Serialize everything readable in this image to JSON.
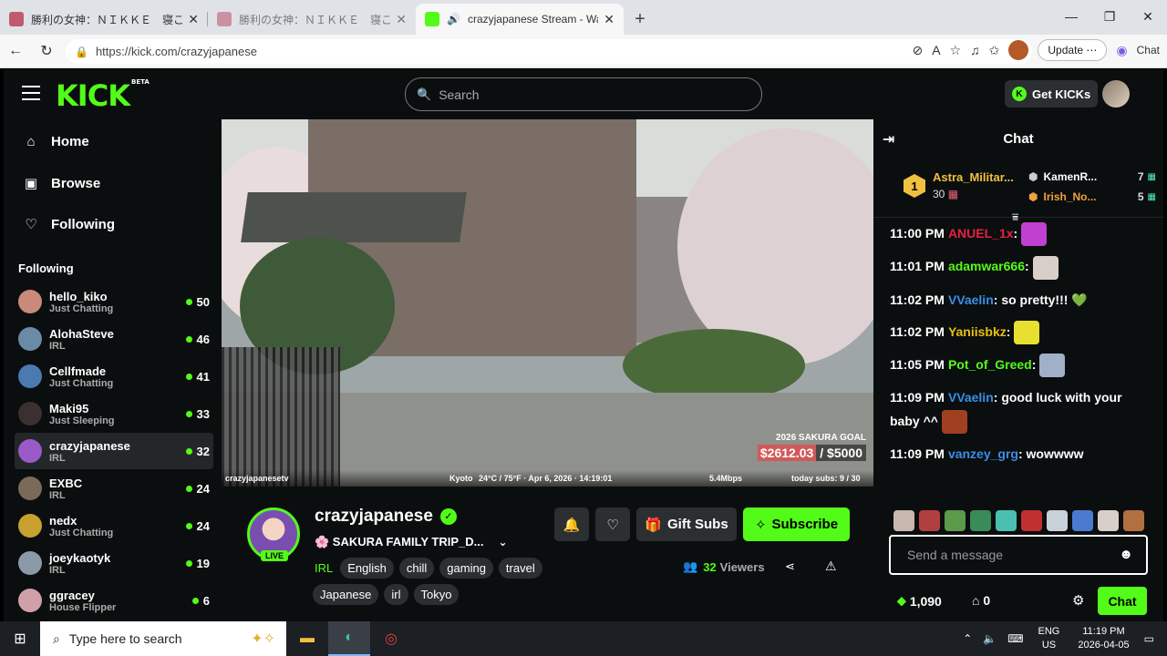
{
  "browser": {
    "tabs": [
      {
        "title": "勝利の女神：ＮＩＫＫＥ　寝ころび",
        "active": false
      },
      {
        "title": "勝利の女神：ＮＩＫＫＥ　寝ころび",
        "active": false
      },
      {
        "title": "crazyjapanese Stream - Watch",
        "active": true
      }
    ],
    "url": "https://kick.com/crazyjapanese",
    "update_label": "Update",
    "chat_label": "Chat"
  },
  "kick": {
    "logo": "KICK",
    "beta": "BETA",
    "search_placeholder": "Search",
    "get_kicks": "Get KICKs"
  },
  "sidebar": {
    "nav": [
      {
        "label": "Home",
        "icon": "home-icon"
      },
      {
        "label": "Browse",
        "icon": "browse-icon"
      },
      {
        "label": "Following",
        "icon": "heart-icon"
      }
    ],
    "following_header": "Following",
    "following": [
      {
        "name": "hello_kiko",
        "category": "Just Chatting",
        "viewers": "50",
        "color": "#c98a7a"
      },
      {
        "name": "AlohaSteve",
        "category": "IRL",
        "viewers": "46",
        "color": "#6a8aa8"
      },
      {
        "name": "Cellfmade",
        "category": "Just Chatting",
        "viewers": "41",
        "color": "#4a7ab0"
      },
      {
        "name": "Maki95",
        "category": "Just Sleeping",
        "viewers": "33",
        "color": "#3a3030"
      },
      {
        "name": "crazyjapanese",
        "category": "IRL",
        "viewers": "32",
        "color": "#9a5ac8"
      },
      {
        "name": "EXBC",
        "category": "IRL",
        "viewers": "24",
        "color": "#7a6a5a"
      },
      {
        "name": "nedx",
        "category": "Just Chatting",
        "viewers": "24",
        "color": "#c8a030"
      },
      {
        "name": "joeykaotyk",
        "category": "IRL",
        "viewers": "19",
        "color": "#8a9aa8"
      },
      {
        "name": "ggracey",
        "category": "House Flipper",
        "viewers": "6",
        "color": "#d0a0a8"
      }
    ]
  },
  "video": {
    "goal_title": "2026 SAKURA GOAL",
    "goal_current": "$2612.03",
    "goal_target": "/ $5000",
    "overlay_user": "crazyjapanesetv",
    "overlay_location": "Kyoto",
    "overlay_weather": "24°C / 75°F · Apr 6, 2026 · 14:19:01",
    "overlay_bitrate": "5.4Mbps",
    "overlay_subs": "today subs: 9 / 30"
  },
  "channel": {
    "name": "crazyjapanese",
    "live": "LIVE",
    "title": "🌸 SAKURA FAMILY TRIP_D...",
    "category": "IRL",
    "tags": [
      "English",
      "chill",
      "gaming",
      "travel",
      "Japanese",
      "irl",
      "Tokyo"
    ],
    "gift_subs": "Gift Subs",
    "subscribe": "Subscribe",
    "viewers_count": "32",
    "viewers_label": "Viewers"
  },
  "chat": {
    "title": "Chat",
    "leaderboard": [
      {
        "rank": "1",
        "name": "Astra_Militar...",
        "value": "30"
      },
      {
        "name": "KamenR...",
        "value": "7"
      },
      {
        "name": "Irish_No...",
        "value": "5"
      }
    ],
    "messages": [
      {
        "time": "11:00 PM",
        "user": "ANUEL_1x",
        "color": "#e8213f",
        "text": "",
        "emote": "#c040d0"
      },
      {
        "time": "11:01 PM",
        "user": "adamwar666",
        "color": "#53fc18",
        "text": "",
        "emote": "#d8d0c8"
      },
      {
        "time": "11:02 PM",
        "user": "VVaelin",
        "color": "#3a8ee6",
        "text": "so pretty!!!",
        "heart": "💚"
      },
      {
        "time": "11:02 PM",
        "user": "Yaniisbkz",
        "color": "#e8c010",
        "text": "",
        "emote": "#e8e030"
      },
      {
        "time": "11:05 PM",
        "user": "Pot_of_Greed",
        "color": "#53fc18",
        "text": "",
        "emote": "#a0b0c8"
      },
      {
        "time": "11:09 PM",
        "user": "VVaelin",
        "color": "#3a8ee6",
        "text": "good luck with your baby ^^",
        "emote": "#a04020"
      },
      {
        "time": "11:09 PM",
        "user": "vanzey_grg",
        "color": "#3a8ee6",
        "text": "wowwww"
      }
    ],
    "input_placeholder": "Send a message",
    "points": "1,090",
    "store_count": "0",
    "send_label": "Chat"
  },
  "taskbar": {
    "search_placeholder": "Type here to search",
    "lang": "ENG",
    "region": "US",
    "time": "11:19 PM",
    "date": "2026-04-05"
  }
}
